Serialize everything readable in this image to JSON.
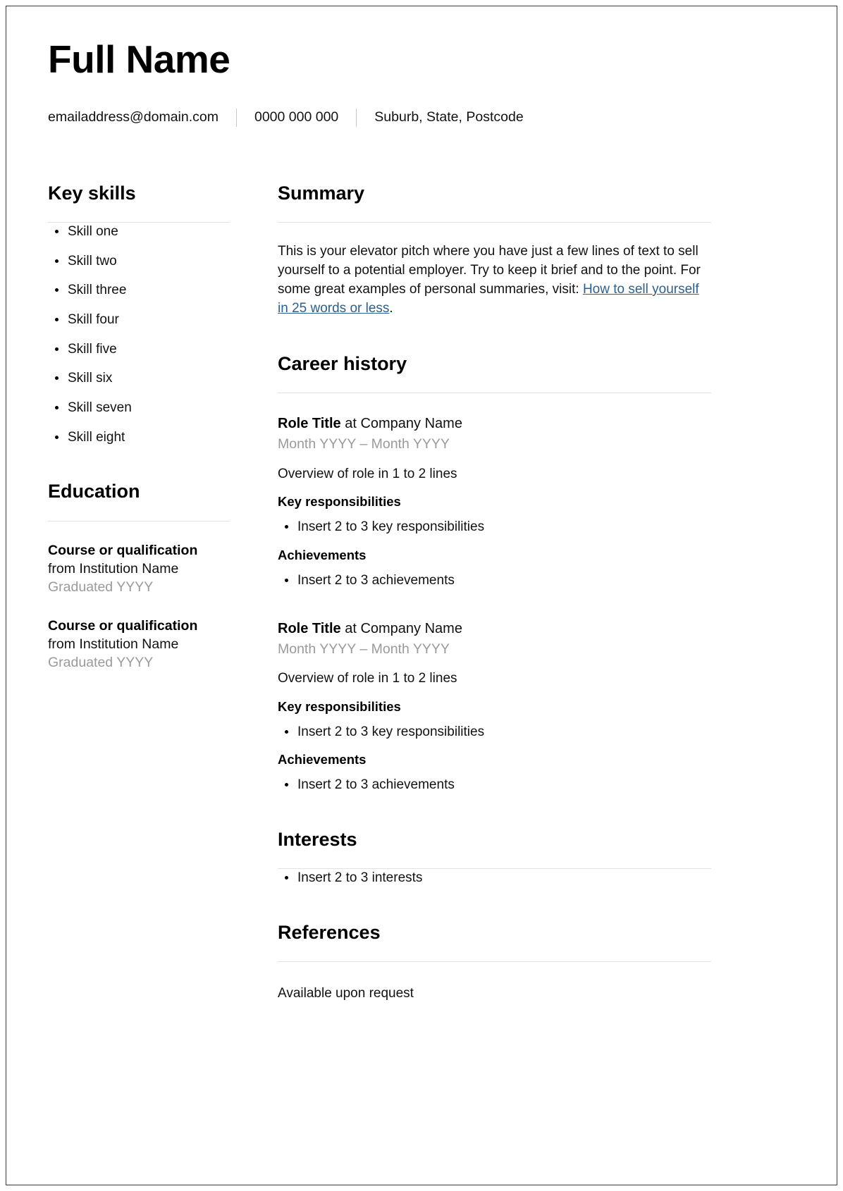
{
  "document": {
    "header": {
      "full_name": "Full Name",
      "contact": {
        "email": "emailaddress@domain.com",
        "phone": "0000 000 000",
        "location": "Suburb, State, Postcode"
      }
    },
    "sidebar": {
      "key_skills": {
        "title": "Key skills",
        "items": [
          "Skill one",
          "Skill two",
          "Skill three",
          "Skill four",
          "Skill five",
          "Skill six",
          "Skill seven",
          "Skill eight"
        ]
      },
      "education": {
        "title": "Education",
        "entries": [
          {
            "course": "Course or qualification",
            "institution": "from Institution Name",
            "graduated": "Graduated YYYY"
          },
          {
            "course": "Course or qualification",
            "institution": "from Institution Name",
            "graduated": "Graduated YYYY"
          }
        ]
      }
    },
    "main": {
      "summary": {
        "title": "Summary",
        "text_before_link": "This is your elevator pitch where you have just a few lines of text to sell yourself to a potential employer. Try to keep it brief and to the point. For some great examples of personal summaries, visit: ",
        "link_text": "How to sell yourself in 25 words or less",
        "text_after_link": "."
      },
      "career_history": {
        "title": "Career history",
        "roles": [
          {
            "role_title": "Role Title",
            "company": " at Company Name",
            "dates": "Month YYYY – Month YYYY",
            "overview": "Overview of role in 1 to 2 lines",
            "responsibilities_heading": "Key responsibilities",
            "responsibilities": [
              "Insert 2 to 3 key responsibilities"
            ],
            "achievements_heading": "Achievements",
            "achievements": [
              "Insert 2 to 3 achievements"
            ]
          },
          {
            "role_title": "Role Title",
            "company": " at Company Name",
            "dates": "Month YYYY – Month YYYY",
            "overview": "Overview of role in 1 to 2 lines",
            "responsibilities_heading": "Key responsibilities",
            "responsibilities": [
              "Insert 2 to 3 key responsibilities"
            ],
            "achievements_heading": "Achievements",
            "achievements": [
              "Insert 2 to 3 achievements"
            ]
          }
        ]
      },
      "interests": {
        "title": "Interests",
        "items": [
          "Insert 2 to 3 interests"
        ]
      },
      "references": {
        "title": "References",
        "text": "Available upon request"
      }
    },
    "colors": {
      "text": "#111111",
      "muted": "#9a9a9a",
      "link": "#2e5f8c",
      "rule": "#e2e2e2",
      "page_border": "#3a3a3a"
    }
  }
}
